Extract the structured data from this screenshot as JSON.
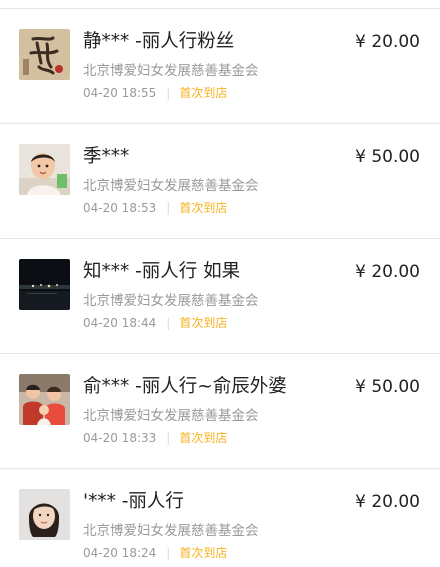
{
  "currency_symbol": "¥",
  "status_color": "#f6b21a",
  "donations": [
    {
      "name": "静*** -丽人行粉丝",
      "amount": "20.00",
      "org": "北京博爱妇女发展慈善基金会",
      "time": "04-20 18:55",
      "status": "首次到店",
      "avatar": "calligraphy-artwork"
    },
    {
      "name": "季***",
      "amount": "50.00",
      "org": "北京博爱妇女发展慈善基金会",
      "time": "04-20 18:53",
      "status": "首次到店",
      "avatar": "baby-photo"
    },
    {
      "name": "知*** -丽人行 如果",
      "amount": "20.00",
      "org": "北京博爱妇女发展慈善基金会",
      "time": "04-20 18:44",
      "status": "首次到店",
      "avatar": "night-skyline"
    },
    {
      "name": "俞*** -丽人行~俞辰外婆",
      "amount": "50.00",
      "org": "北京博爱妇女发展慈善基金会",
      "time": "04-20 18:33",
      "status": "首次到店",
      "avatar": "family-photo"
    },
    {
      "name": "'*** -丽人行",
      "amount": "20.00",
      "org": "北京博爱妇女发展慈善基金会",
      "time": "04-20 18:24",
      "status": "首次到店",
      "avatar": "woman-portrait"
    }
  ]
}
